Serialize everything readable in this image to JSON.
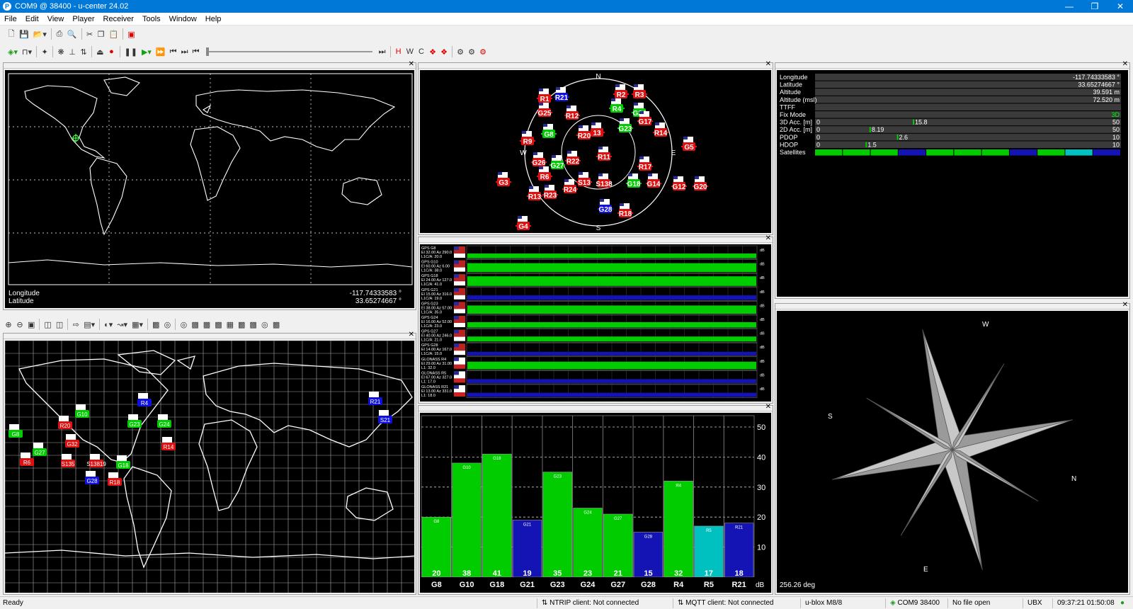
{
  "window": {
    "title": "COM9 @ 38400 - u-center 24.02",
    "app_icon": "P",
    "controls": [
      "minimize-icon",
      "restore-icon",
      "close-icon"
    ]
  },
  "menu": [
    "File",
    "Edit",
    "View",
    "Player",
    "Receiver",
    "Tools",
    "Window",
    "Help"
  ],
  "map_panel": {
    "longitude_label": "Longitude",
    "latitude_label": "Latitude",
    "longitude_value": "-117.74333583 °",
    "latitude_value": "33.65274667 °"
  },
  "data_panel": {
    "rows": [
      {
        "label": "Longitude",
        "value": "-117.74333583 °"
      },
      {
        "label": "Latitude",
        "value": "33.65274667 °"
      },
      {
        "label": "Altitude",
        "value": "39.591 m"
      },
      {
        "label": "Altitude (msl)",
        "value": "72.520 m"
      },
      {
        "label": "TTFF",
        "value": ""
      },
      {
        "label": "Fix Mode",
        "value": "3D"
      }
    ],
    "bars": [
      {
        "label": "3D Acc. [m]",
        "min": "0",
        "value": 15.8,
        "value_text": "15.8",
        "max": "50",
        "max_num": 50
      },
      {
        "label": "2D Acc. [m]",
        "min": "0",
        "value": 8.19,
        "value_text": "8.19",
        "max": "50",
        "max_num": 50
      },
      {
        "label": "PDOP",
        "min": "0",
        "value": 2.6,
        "value_text": "2.6",
        "max": "10",
        "max_num": 10
      },
      {
        "label": "HDOP",
        "min": "0",
        "value": 1.5,
        "value_text": "1.5",
        "max": "10",
        "max_num": 10
      }
    ],
    "satellites_label": "Satellites",
    "fix_color": "#00ff00"
  },
  "sky_view": {
    "compass": [
      "N",
      "E",
      "S",
      "W"
    ],
    "gps_color": "#00cc00",
    "glonass_color": "#e01010",
    "sbas_color": "#1010e0",
    "sats": [
      {
        "id": "R1",
        "c": "r"
      },
      {
        "id": "R21",
        "c": "b"
      },
      {
        "id": "R2",
        "c": "r"
      },
      {
        "id": "R3",
        "c": "r"
      },
      {
        "id": "G25",
        "c": "r"
      },
      {
        "id": "R12",
        "c": "r"
      },
      {
        "id": "R4",
        "c": "g"
      },
      {
        "id": "G24",
        "c": "g"
      },
      {
        "id": "G17",
        "c": "r"
      },
      {
        "id": "G23",
        "c": "g"
      },
      {
        "id": "R14",
        "c": "r"
      },
      {
        "id": "G8",
        "c": "g"
      },
      {
        "id": "R20",
        "c": "r"
      },
      {
        "id": "13",
        "c": "r"
      },
      {
        "id": "R9",
        "c": "r"
      },
      {
        "id": "G5",
        "c": "r"
      },
      {
        "id": "G26",
        "c": "r"
      },
      {
        "id": "G27",
        "c": "g"
      },
      {
        "id": "R22",
        "c": "r"
      },
      {
        "id": "R11",
        "c": "r"
      },
      {
        "id": "R17",
        "c": "r"
      },
      {
        "id": "R6",
        "c": "r"
      },
      {
        "id": "G3",
        "c": "r"
      },
      {
        "id": "R24",
        "c": "r"
      },
      {
        "id": "S13",
        "c": "r"
      },
      {
        "id": "S138",
        "c": "r"
      },
      {
        "id": "G18",
        "c": "g"
      },
      {
        "id": "G14",
        "c": "r"
      },
      {
        "id": "G12",
        "c": "r"
      },
      {
        "id": "G20",
        "c": "r"
      },
      {
        "id": "R13",
        "c": "r"
      },
      {
        "id": "R23",
        "c": "r"
      },
      {
        "id": "G28",
        "c": "b"
      },
      {
        "id": "R18",
        "c": "r"
      },
      {
        "id": "G4",
        "c": "r"
      }
    ]
  },
  "signal_history": {
    "rows": [
      {
        "name": "GPS G8",
        "info": "El 32.00 Az 290.0",
        "sig": "L1C/A: 20.0"
      },
      {
        "name": "GPS G10",
        "info": "El 60.00 Az 6.00",
        "sig": "L1C/A: 38.0"
      },
      {
        "name": "GPS G18",
        "info": "El 24.00 Az 127.0",
        "sig": "L1C/A: 41.0"
      },
      {
        "name": "GPS G21",
        "info": "El 15.00 Az 316.0",
        "sig": "L1C/A: 19.0"
      },
      {
        "name": "GPS G23",
        "info": "El 38.00 Az 57.00",
        "sig": "L1C/A: 35.0"
      },
      {
        "name": "GPS G24",
        "info": "El 16.00 Az 52.00",
        "sig": "L1C/A: 23.0"
      },
      {
        "name": "GPS G27",
        "info": "El 40.00 Az 246.0",
        "sig": "L1C/A: 21.0"
      },
      {
        "name": "GPS G28",
        "info": "El 14.00 Az 167.0",
        "sig": "L1C/A: 15.0"
      },
      {
        "name": "GLONASS R4",
        "info": "El 29.00 Az 31.00",
        "sig": "L1: 32.0"
      },
      {
        "name": "GLONASS R5",
        "info": "El 67.00 Az 327.0",
        "sig": "L1: 17.0"
      },
      {
        "name": "GLONASS R21",
        "info": "El 13.00 Az 331.0",
        "sig": "L1: 18.0"
      }
    ],
    "unit": "dB"
  },
  "chart_data": {
    "type": "bar",
    "categories": [
      "G8",
      "G10",
      "G18",
      "G21",
      "G23",
      "G24",
      "G27",
      "G28",
      "R4",
      "R5",
      "R21"
    ],
    "values": [
      20,
      38,
      41,
      19,
      35,
      23,
      21,
      15,
      32,
      17,
      18
    ],
    "value_labels": [
      "20",
      "38",
      "41",
      "19",
      "35",
      "23",
      "21",
      "15",
      "32",
      "17",
      "18"
    ],
    "bar_colors": [
      "#00cc00",
      "#00cc00",
      "#00cc00",
      "#1414b4",
      "#00cc00",
      "#00cc00",
      "#00cc00",
      "#1414b4",
      "#00cc00",
      "#00c0c0",
      "#1414b4"
    ],
    "yticks": [
      "10",
      "20",
      "30",
      "40",
      "50"
    ],
    "ylim": [
      0,
      50
    ],
    "unit": "dB",
    "grid": true
  },
  "compass_panel": {
    "heading": "256.26 deg",
    "labels": [
      "W",
      "N",
      "E",
      "S"
    ]
  },
  "status": {
    "ready": "Ready",
    "ntrip": "NTRIP client: Not connected",
    "mqtt": "MQTT client: Not connected",
    "receiver": "u-blox M8/8",
    "port": "COM9 38400",
    "file": "No file open",
    "protocol": "UBX",
    "time": "09:37:21 01:50:08"
  }
}
